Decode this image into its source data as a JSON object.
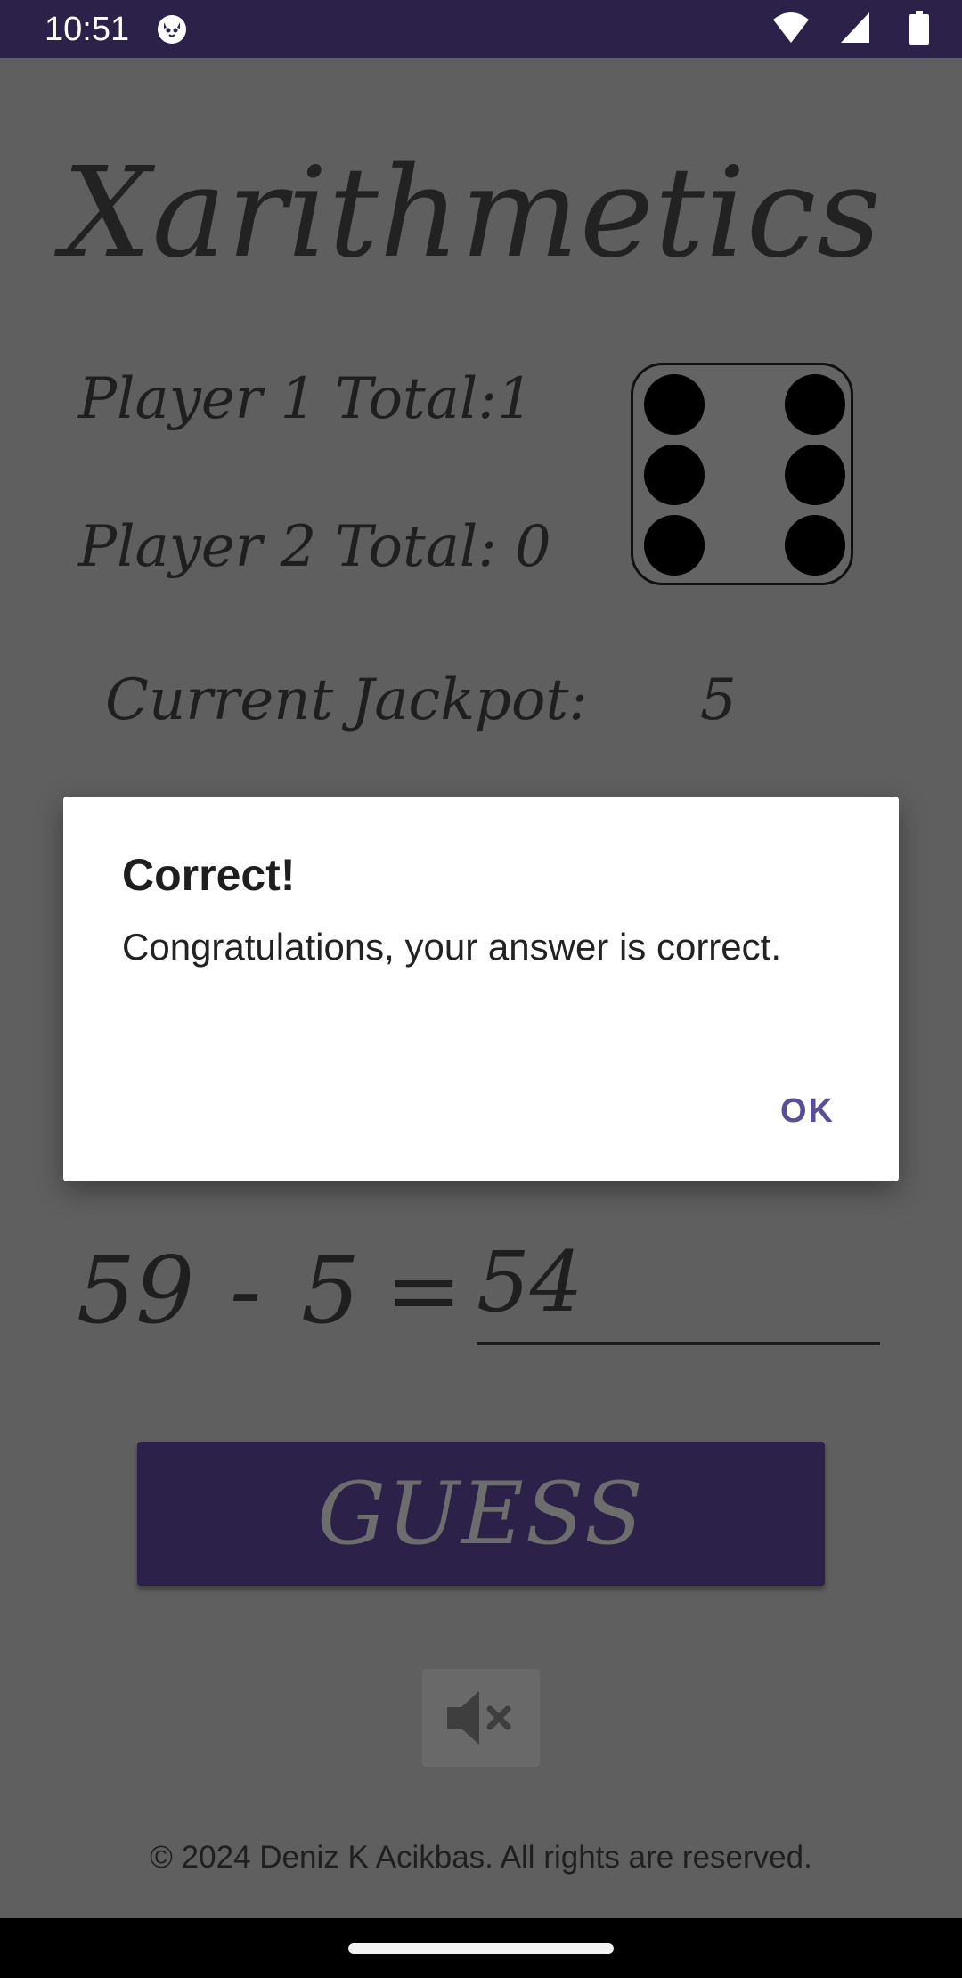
{
  "status_bar": {
    "time": "10:51",
    "app_icon": "cat-icon",
    "icons": [
      "wifi-icon",
      "cellular-signal-icon",
      "battery-icon"
    ]
  },
  "app": {
    "title": "Xarithmetics"
  },
  "scores": {
    "player1_label": "Player 1 Total:",
    "player1_value": "1",
    "player2_label": "Player 2 Total:",
    "player2_value": "0",
    "jackpot_label": "Current Jackpot:",
    "jackpot_value": "5"
  },
  "die": {
    "face_value": 6,
    "icon": "die-six-icon"
  },
  "equation": {
    "left_operand": "59",
    "operator": "-",
    "right_operand": "5",
    "equals": "=",
    "answer_value": "54"
  },
  "buttons": {
    "guess_label": "GUESS",
    "mute_icon": "volume-mute-icon"
  },
  "footer": {
    "copyright": "© 2024 Deniz K Acikbas. All rights are reserved."
  },
  "dialog": {
    "title": "Correct!",
    "message": "Congratulations, your answer is correct.",
    "ok_label": "OK"
  },
  "colors": {
    "status_bar": "#2c2148",
    "background_dimmed": "#5f5f5f",
    "guess_button": "#2c2148",
    "dialog_accent": "#5b4d96"
  }
}
